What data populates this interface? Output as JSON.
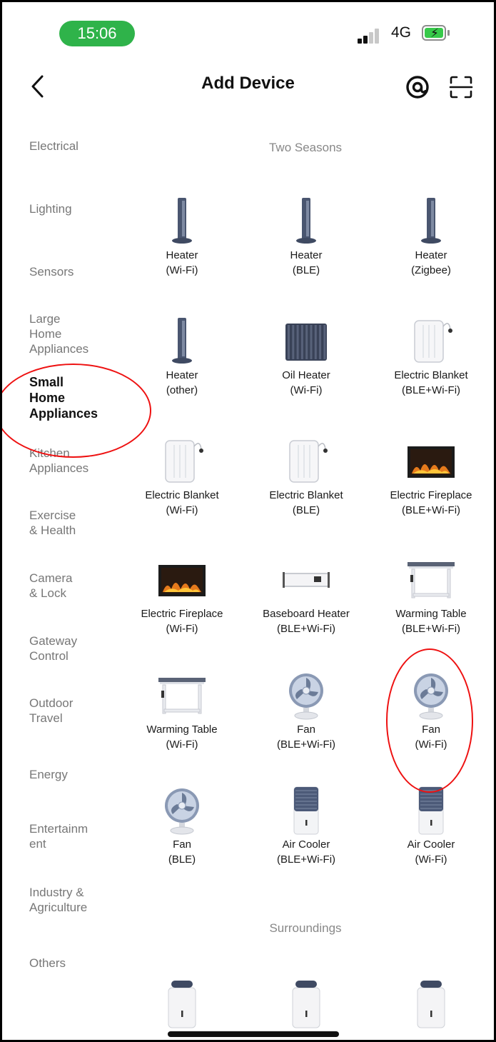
{
  "status": {
    "time": "15:06",
    "network": "4G"
  },
  "header": {
    "title": "Add Device"
  },
  "sidebar": {
    "items": [
      {
        "label": "Electrical"
      },
      {
        "label": "Lighting"
      },
      {
        "label": "Sensors"
      },
      {
        "label": "Large\nHome\nAppliances"
      },
      {
        "label": "Small\nHome\nAppliances"
      },
      {
        "label": "Kitchen\nAppliances"
      },
      {
        "label": "Exercise\n& Health"
      },
      {
        "label": "Camera\n& Lock"
      },
      {
        "label": "Gateway\nControl"
      },
      {
        "label": "Outdoor\nTravel"
      },
      {
        "label": "Energy"
      },
      {
        "label": "Entertainm\nent"
      },
      {
        "label": "Industry &\nAgriculture"
      },
      {
        "label": "Others"
      }
    ],
    "active_index": 4
  },
  "sections": [
    {
      "title": "Two Seasons"
    },
    {
      "title": "Surroundings"
    }
  ],
  "devices": [
    {
      "name": "Heater",
      "protocol": "(Wi-Fi)",
      "icon": "heater-tower"
    },
    {
      "name": "Heater",
      "protocol": "(BLE)",
      "icon": "heater-tower"
    },
    {
      "name": "Heater",
      "protocol": "(Zigbee)",
      "icon": "heater-tower"
    },
    {
      "name": "Heater",
      "protocol": "(other)",
      "icon": "heater-tower"
    },
    {
      "name": "Oil Heater",
      "protocol": "(Wi-Fi)",
      "icon": "oil-heater"
    },
    {
      "name": "Electric Blanket",
      "protocol": "(BLE+Wi-Fi)",
      "icon": "electric-blanket"
    },
    {
      "name": "Electric Blanket",
      "protocol": "(Wi-Fi)",
      "icon": "electric-blanket"
    },
    {
      "name": "Electric Blanket",
      "protocol": "(BLE)",
      "icon": "electric-blanket"
    },
    {
      "name": "Electric Fireplace",
      "protocol": "(BLE+Wi-Fi)",
      "icon": "fireplace"
    },
    {
      "name": "Electric Fireplace",
      "protocol": "(Wi-Fi)",
      "icon": "fireplace"
    },
    {
      "name": "Baseboard Heater",
      "protocol": "(BLE+Wi-Fi)",
      "icon": "baseboard-heater"
    },
    {
      "name": "Warming Table",
      "protocol": "(BLE+Wi-Fi)",
      "icon": "warming-table"
    },
    {
      "name": "Warming Table",
      "protocol": "(Wi-Fi)",
      "icon": "warming-table"
    },
    {
      "name": "Fan",
      "protocol": "(BLE+Wi-Fi)",
      "icon": "fan"
    },
    {
      "name": "Fan",
      "protocol": "(Wi-Fi)",
      "icon": "fan"
    },
    {
      "name": "Fan",
      "protocol": "(BLE)",
      "icon": "fan"
    },
    {
      "name": "Air Cooler",
      "protocol": "(BLE+Wi-Fi)",
      "icon": "air-cooler"
    },
    {
      "name": "Air Cooler",
      "protocol": "(Wi-Fi)",
      "icon": "air-cooler"
    }
  ],
  "surroundings_devices": [
    {
      "icon": "air-purifier"
    },
    {
      "icon": "air-purifier"
    },
    {
      "icon": "air-purifier"
    }
  ],
  "colors": {
    "annotation": "#e11111",
    "status_pill": "#2fb34a",
    "battery": "#37c94a"
  }
}
